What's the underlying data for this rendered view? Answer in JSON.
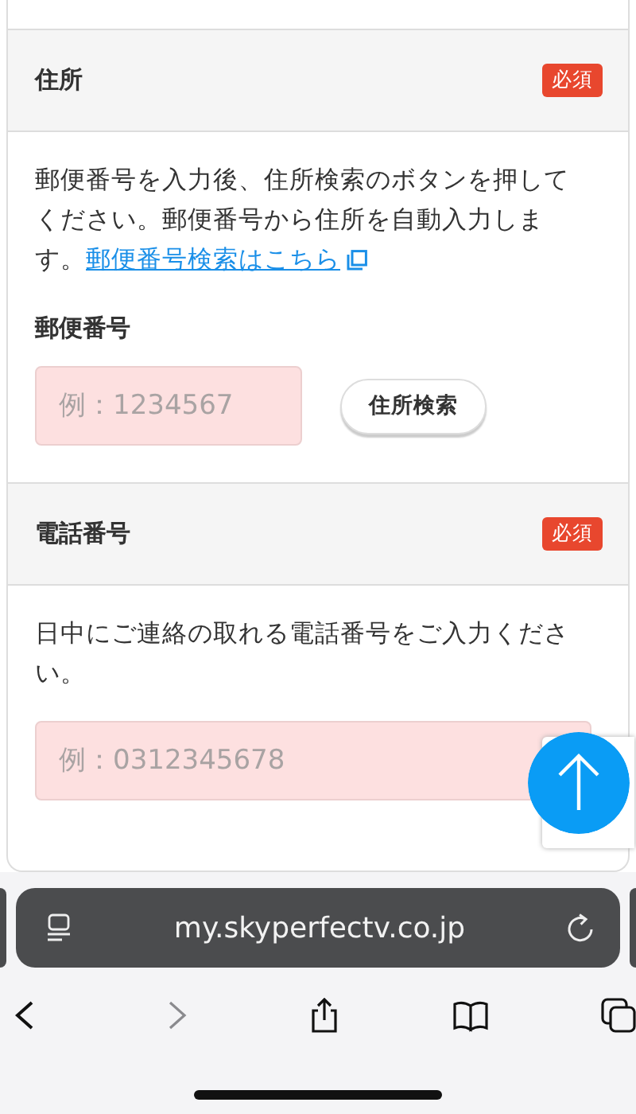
{
  "sections": [
    {
      "title": "住所",
      "badge": "必須",
      "description": "郵便番号を入力後、住所検索のボタンを押してください。郵便番号から住所を自動入力します。",
      "link": "郵便番号検索はこちら",
      "field": {
        "label": "郵便番号",
        "placeholder": "例：1234567",
        "error": true,
        "button": "住所検索"
      }
    },
    {
      "title": "電話番号",
      "badge": "必須",
      "description": "日中にご連絡の取れる電話番号をご入力ください。",
      "field": {
        "placeholder": "例：0312345678",
        "error": true
      }
    }
  ],
  "browser": {
    "url": "my.skyperfectv.co.jp",
    "toolbar": [
      {
        "kind": "back",
        "disabled": false
      },
      {
        "kind": "forward",
        "disabled": true
      },
      {
        "kind": "share",
        "disabled": false
      },
      {
        "kind": "bookmarks",
        "disabled": false
      },
      {
        "kind": "tabs",
        "disabled": false
      }
    ]
  }
}
